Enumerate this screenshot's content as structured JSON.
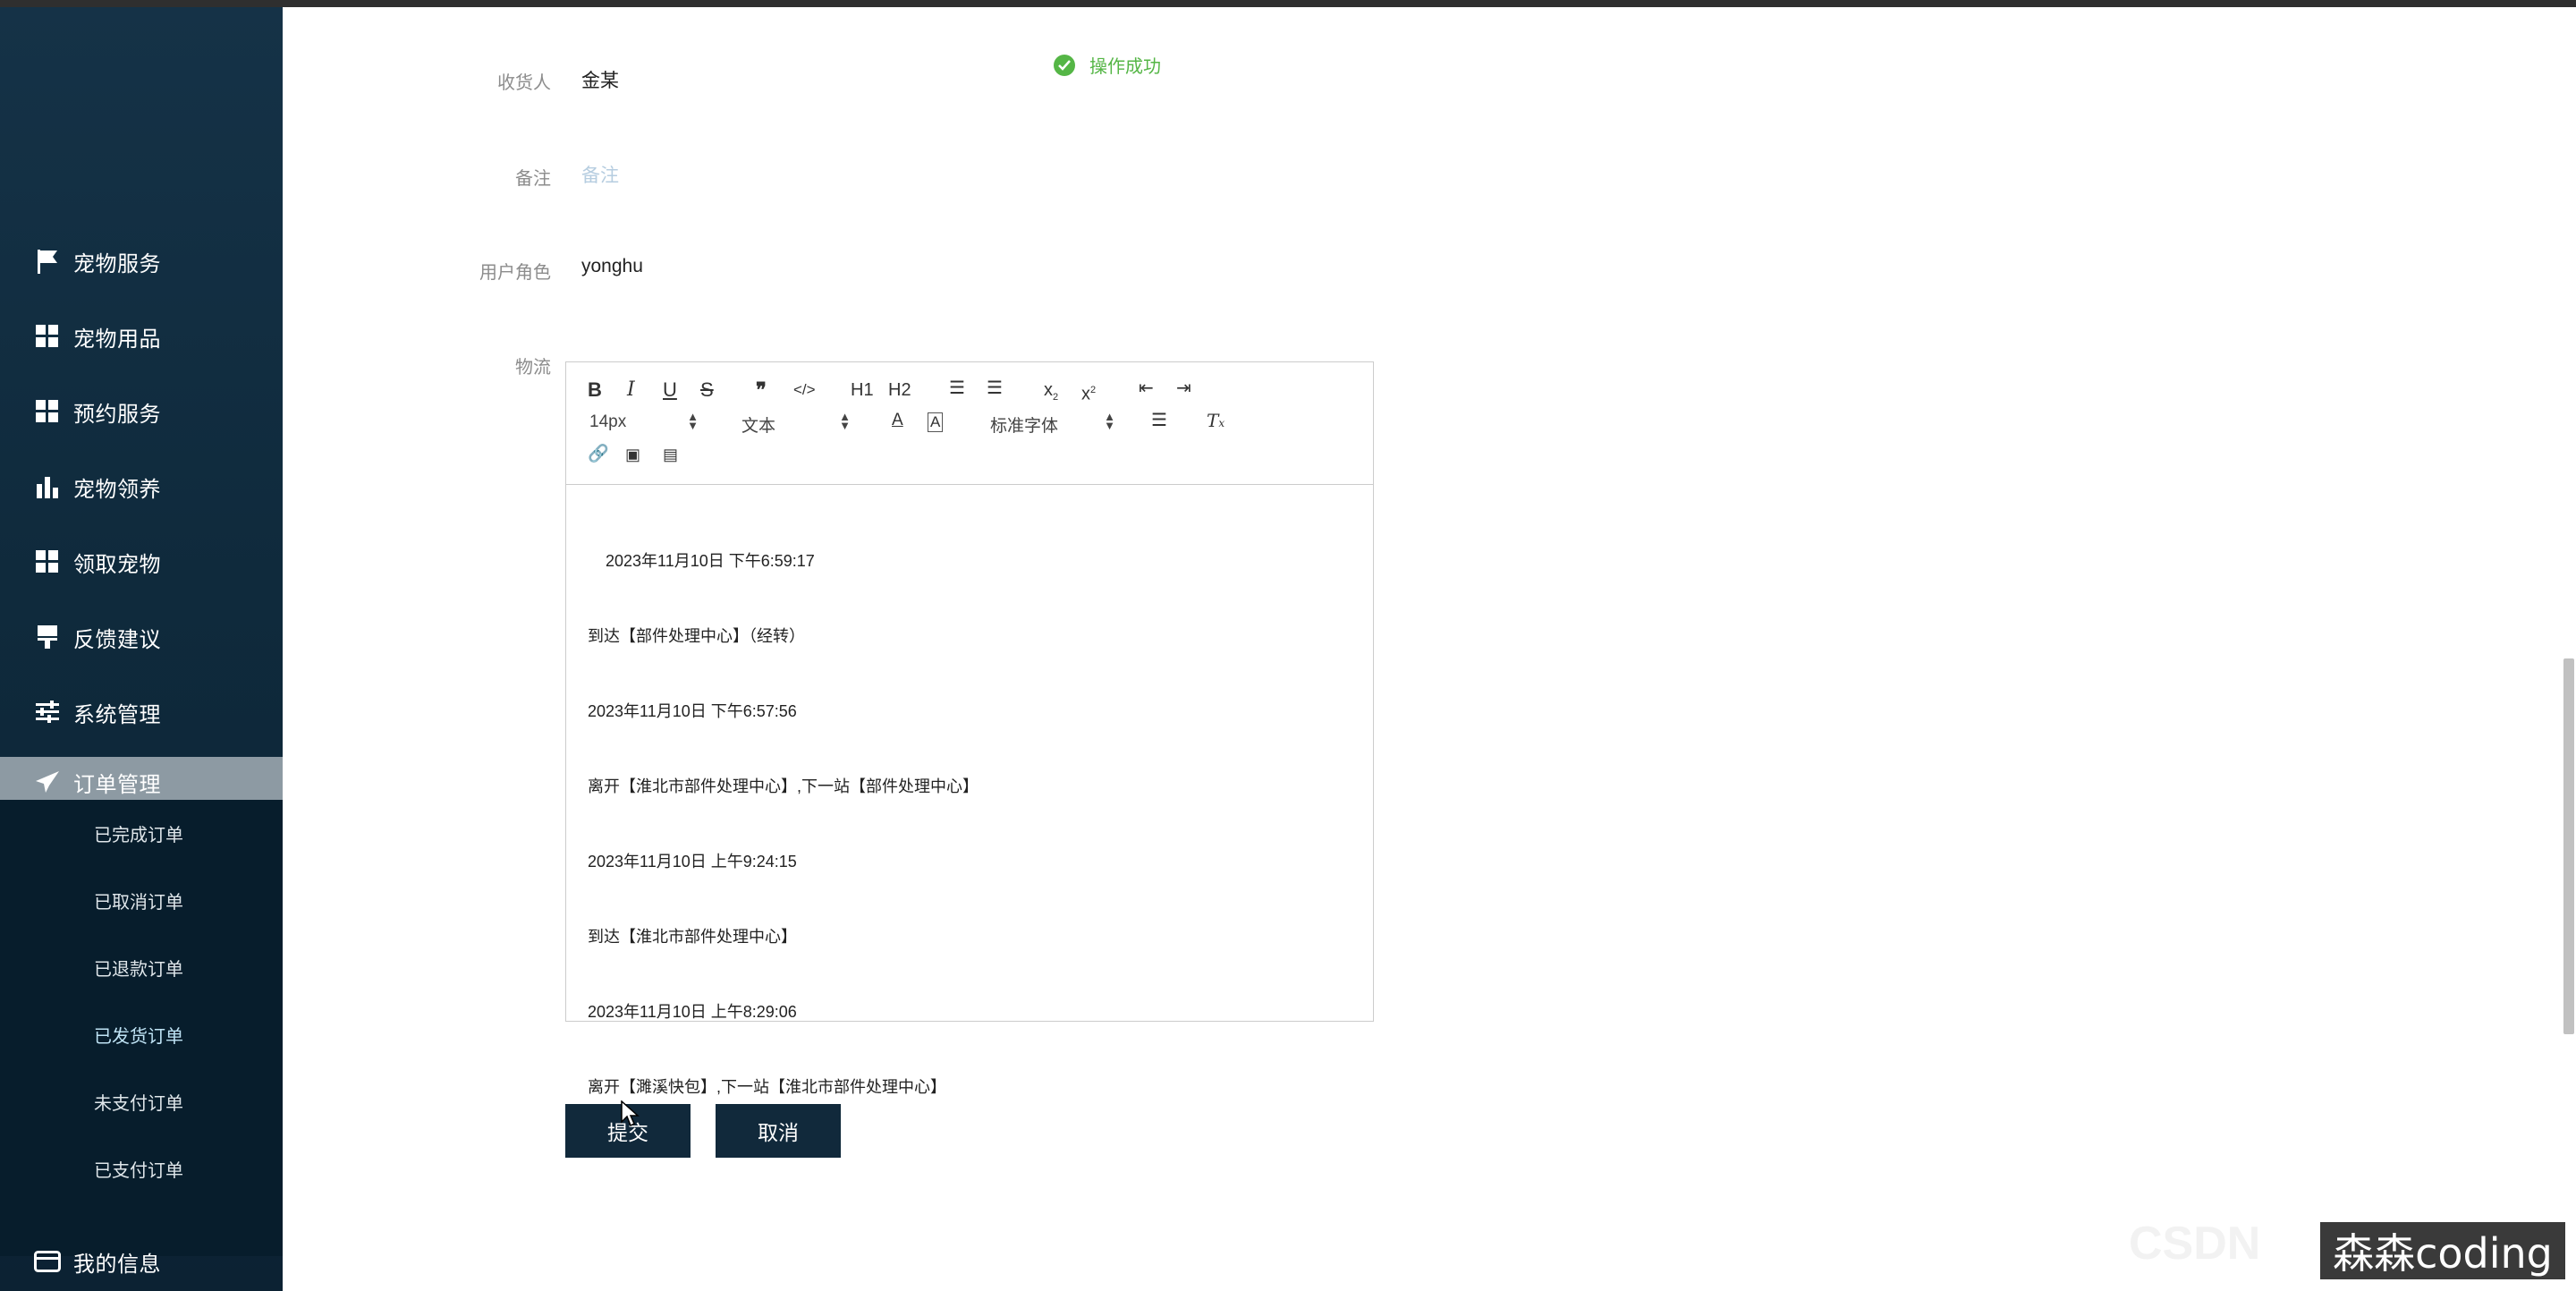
{
  "sidebar": {
    "items": [
      {
        "label": "宠物服务",
        "icon": "flag-icon"
      },
      {
        "label": "宠物用品",
        "icon": "grid-icon"
      },
      {
        "label": "预约服务",
        "icon": "grid-icon"
      },
      {
        "label": "宠物领养",
        "icon": "bar-chart-icon"
      },
      {
        "label": "领取宠物",
        "icon": "grid-icon"
      },
      {
        "label": "反馈建议",
        "icon": "brush-icon"
      },
      {
        "label": "系统管理",
        "icon": "sliders-icon"
      },
      {
        "label": "订单管理",
        "icon": "send-icon"
      },
      {
        "label": "我的信息",
        "icon": "wallet-icon"
      }
    ],
    "submenu": [
      "已完成订单",
      "已取消订单",
      "已退款订单",
      "已发货订单",
      "未支付订单",
      "已支付订单"
    ]
  },
  "form": {
    "receiver": {
      "label": "收货人",
      "value": "金某"
    },
    "remark": {
      "label": "备注",
      "placeholder": "备注"
    },
    "role": {
      "label": "用户角色",
      "value": "yonghu"
    },
    "logistics": {
      "label": "物流"
    }
  },
  "toast": {
    "text": "操作成功",
    "color": "#55b646"
  },
  "editor": {
    "toolbar": {
      "font_size": "14px",
      "header_select": "文本",
      "font_family": "标准字体",
      "h1": "H1",
      "h2": "H2"
    },
    "lines": [
      "    2023年11月10日 下午6:59:17",
      "到达【部件处理中心】（经转）",
      "2023年11月10日 下午6:57:56",
      "离开【淮北市部件处理中心】,下一站【部件处理中心】",
      "2023年11月10日 上午9:24:15",
      "到达【淮北市部件处理中心】",
      "2023年11月10日 上午8:29:06",
      "离开【濉溪快包】,下一站【淮北市部件处理中心】"
    ]
  },
  "buttons": {
    "submit": "提交",
    "cancel": "取消"
  },
  "watermark": {
    "text": "森森coding",
    "faint": "CSDN"
  },
  "colors": {
    "sidebar": "#153247",
    "active": "#8d9aa3",
    "button": "#11293b"
  }
}
